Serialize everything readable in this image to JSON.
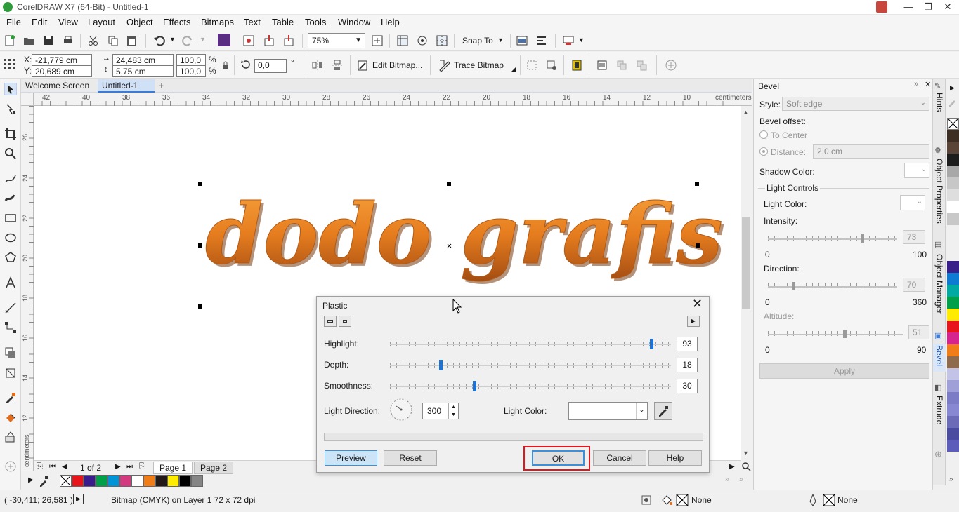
{
  "window": {
    "title": "CorelDRAW X7 (64-Bit) - Untitled-1",
    "controls": [
      "—",
      "❐",
      "✕"
    ]
  },
  "menu": [
    "File",
    "Edit",
    "View",
    "Layout",
    "Object",
    "Effects",
    "Bitmaps",
    "Text",
    "Table",
    "Tools",
    "Window",
    "Help"
  ],
  "toolbar": {
    "zoom": "75%",
    "snap_to": "Snap To"
  },
  "propbar": {
    "x": "-21,779 cm",
    "y": "20,689 cm",
    "x_label": "X:",
    "y_label": "Y:",
    "width": "24,483 cm",
    "height": "5,75 cm",
    "scale_x": "100,0",
    "scale_y": "100,0",
    "pct": "%",
    "rotation": "0,0",
    "deg": "°",
    "edit_bitmap": "Edit Bitmap...",
    "trace_bitmap": "Trace Bitmap"
  },
  "doc_tabs": [
    "Welcome Screen",
    "Untitled-1",
    "+"
  ],
  "rulers": {
    "h_ticks": [
      "42",
      "40",
      "38",
      "36",
      "34",
      "32",
      "30",
      "28",
      "26",
      "24",
      "22",
      "20",
      "18",
      "16",
      "14",
      "12",
      "10"
    ],
    "h_unit": "centimeters",
    "v_ticks": [
      "26",
      "24",
      "22",
      "20",
      "18",
      "16",
      "14",
      "12"
    ],
    "v_unit": "centimeters"
  },
  "canvas": {
    "art_text": "dodo grafis"
  },
  "pages": {
    "counter": "1 of 2",
    "tabs": [
      "Page 1",
      "Page 2"
    ]
  },
  "status": {
    "coords": "( -30,411; 26,581 )",
    "info": "Bitmap (CMYK) on Layer 1 72 x 72 dpi",
    "fill_none": "None",
    "outline_none": "None"
  },
  "docker": {
    "title": "Bevel",
    "style_label": "Style:",
    "style_value": "Soft edge",
    "offset_label": "Bevel offset:",
    "to_center": "To Center",
    "distance_label": "Distance:",
    "distance_value": "2,0 cm",
    "shadow_color": "Shadow Color:",
    "light_controls": "Light Controls",
    "light_color": "Light Color:",
    "intensity": "Intensity:",
    "intensity_value": "73",
    "intensity_min": "0",
    "intensity_max": "100",
    "direction": "Direction:",
    "direction_value": "70",
    "direction_min": "0",
    "direction_max": "360",
    "altitude": "Altitude:",
    "altitude_value": "51",
    "altitude_min": "0",
    "altitude_max": "90",
    "apply": "Apply",
    "intensity_level": 0.73,
    "direction_level": 0.194,
    "altitude_level": 0.567
  },
  "side_tabs": [
    "Hints",
    "Object Properties",
    "Object Manager",
    "Bevel",
    "Extrude"
  ],
  "dialog": {
    "title": "Plastic",
    "highlight_label": "Highlight:",
    "highlight_value": "93",
    "depth_label": "Depth:",
    "depth_value": "18",
    "smoothness_label": "Smoothness:",
    "smoothness_value": "30",
    "light_direction_label": "Light Direction:",
    "light_direction_value": "300",
    "light_color_label": "Light Color:",
    "preview": "Preview",
    "reset": "Reset",
    "ok": "OK",
    "cancel": "Cancel",
    "help": "Help",
    "highlight_level": 0.93,
    "depth_level": 0.18,
    "smoothness_level": 0.3
  },
  "palette_colors": [
    "#e8141b",
    "#3b1c8c",
    "#00a04a",
    "#0094d6",
    "#d2397f",
    "#ffffff",
    "#f07d18",
    "#241a17",
    "#ffeb00",
    "#000000",
    "#858585"
  ],
  "right_palette_colors": [
    "#ffffff",
    "#3d2e24",
    "#5a4437",
    "#1d1d1d",
    "#a8a8a8",
    "#c7c7c7",
    "#dedede",
    "#ffffff",
    "#c8c8c8",
    "#3a1f8a",
    "#0c7bd1",
    "#00a9a2",
    "#00a04a",
    "#ffeb00",
    "#e8141b",
    "#d6248e",
    "#f07d18",
    "#8f6b4e",
    "#c3c3e8",
    "#a0a0d8",
    "#7c7cc6",
    "#8888d2",
    "#6b6bb8",
    "#4b4ba0",
    "#5c5cba"
  ]
}
